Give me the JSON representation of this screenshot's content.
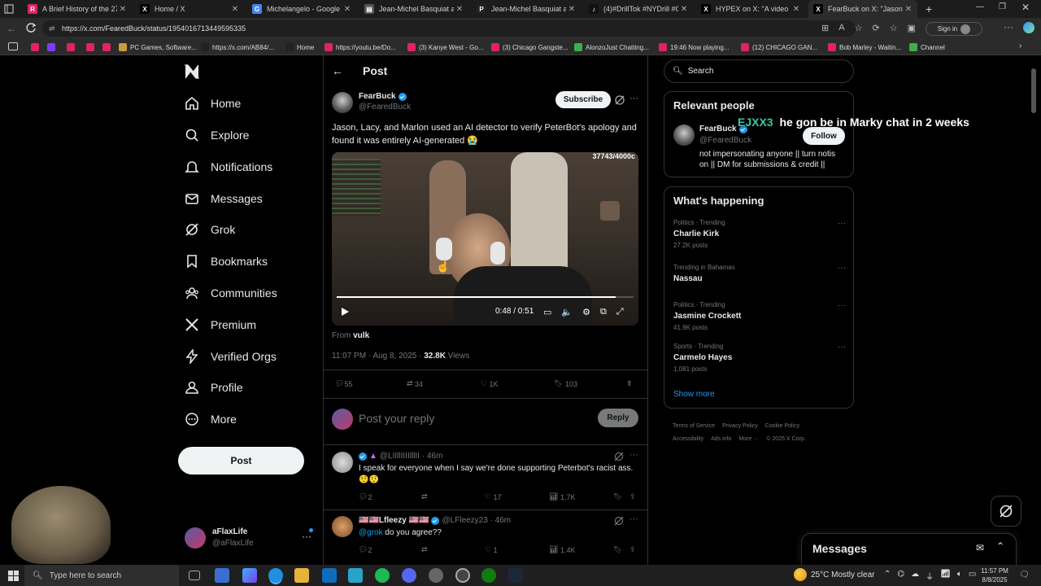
{
  "browser": {
    "tabs": [
      {
        "title": "A Brief History of the 27 Cl",
        "color": "#e0245e",
        "glyph": "R"
      },
      {
        "title": "Home / X",
        "color": "#000000",
        "glyph": "X"
      },
      {
        "title": "Michelangelo - Google Sea",
        "color": "#4285f4",
        "glyph": "G"
      },
      {
        "title": "Jean-Michel Basquiat and A",
        "color": "#555555",
        "glyph": "▤"
      },
      {
        "title": "Jean-Michel Basquiat and A",
        "color": "#222222",
        "glyph": "P"
      },
      {
        "title": "(4)#DrillTok #NYDrill #Chic",
        "color": "#111111",
        "glyph": "♪"
      },
      {
        "title": "HYPEX on X: \"A video surfa",
        "color": "#000000",
        "glyph": "X"
      },
      {
        "title": "FearBuck on X: \"Jason, Lacy",
        "color": "#000000",
        "glyph": "X"
      }
    ],
    "url": "https://x.com/FearedBuck/status/1954016713449595335",
    "sign_in": "Sign in",
    "bookmarks": [
      {
        "label": "",
        "color": "#e0245e"
      },
      {
        "label": "",
        "color": "#7d3cff"
      },
      {
        "label": "",
        "color": "#e0245e"
      },
      {
        "label": "",
        "color": "#e0245e"
      },
      {
        "label": "",
        "color": "#e0245e"
      },
      {
        "label": "PC Games, Software...",
        "color": "#c89b3c"
      },
      {
        "label": "https://x.com/AB84/...",
        "color": "#222222"
      },
      {
        "label": "Home",
        "color": "#222222"
      },
      {
        "label": "https://youtu.be/Do...",
        "color": "#e0245e"
      },
      {
        "label": "(3) Kanye West - Go...",
        "color": "#e0245e"
      },
      {
        "label": "(3) Chicago Gangste...",
        "color": "#e0245e"
      },
      {
        "label": "AlonzoJust Chatting...",
        "color": "#3cb04a"
      },
      {
        "label": "19:46 Now playing...",
        "color": "#e0245e"
      },
      {
        "label": "(12) CHICAGO GAN...",
        "color": "#e0245e"
      },
      {
        "label": "Bob Marley - Waitin...",
        "color": "#e0245e"
      },
      {
        "label": "Channel",
        "color": "#3cb04a"
      }
    ]
  },
  "sidebar": {
    "items": [
      {
        "label": "Home",
        "icon": "home-icon"
      },
      {
        "label": "Explore",
        "icon": "search-icon"
      },
      {
        "label": "Notifications",
        "icon": "bell-icon"
      },
      {
        "label": "Messages",
        "icon": "mail-icon"
      },
      {
        "label": "Grok",
        "icon": "grok-icon"
      },
      {
        "label": "Bookmarks",
        "icon": "bookmark-icon"
      },
      {
        "label": "Communities",
        "icon": "people-icon"
      },
      {
        "label": "Premium",
        "icon": "x-logo-icon"
      },
      {
        "label": "Verified Orgs",
        "icon": "lightning-icon"
      },
      {
        "label": "Profile",
        "icon": "person-icon"
      },
      {
        "label": "More",
        "icon": "more-circle-icon"
      }
    ],
    "post_button": "Post",
    "account": {
      "name": "aFlaxLife",
      "handle": "@aFlaxLife"
    }
  },
  "main": {
    "header_title": "Post",
    "post": {
      "author": "FearBuck",
      "handle": "@FearedBuck",
      "subscribe_label": "Subscribe",
      "text": "Jason, Lacy, and Marlon used an AI detector to verify PeterBot's apology and found it was entirely AI-generated 😭",
      "video": {
        "counter": "37743/4000c",
        "time": "0:48 / 0:51",
        "progress": 0.94
      },
      "from_label": "From",
      "from_name": "vulk",
      "timestamp": "11:07 PM · Aug 8, 2025 ·",
      "views_count": "32.8K",
      "views_label": "Views",
      "stats": {
        "replies": "55",
        "reposts": "34",
        "likes": "1K",
        "bookmarks": "103"
      }
    },
    "reply_box": {
      "placeholder": "Post your reply",
      "button": "Reply"
    },
    "replies": [
      {
        "name": "",
        "handle": "@LIIllIIIIlllII · 46m",
        "text": "I speak for everyone when I say we're done supporting Peterbot's racist ass. 🤨🤨",
        "stats": {
          "replies": "2",
          "reposts": "",
          "likes": "17",
          "views": "1.7K"
        }
      },
      {
        "name": "🇺🇸🇺🇸Lfleezy 🇺🇸🇺🇸",
        "handle": "@LFleezy23 · 46m",
        "mention": "@grok",
        "text": "do you agree??",
        "stats": {
          "replies": "2",
          "reposts": "",
          "likes": "1",
          "views": "1.4K"
        }
      }
    ]
  },
  "right": {
    "search_placeholder": "Search",
    "relevant": {
      "title": "Relevant people",
      "name": "FearBuck",
      "handle": "@FearedBuck",
      "follow": "Follow",
      "bio": "not impersonating anyone || turn notis on || DM for submissions & credit ||"
    },
    "happening": {
      "title": "What's happening",
      "trends": [
        {
          "meta": "Politics · Trending",
          "name": "Charlie Kirk",
          "posts": "27.2K posts"
        },
        {
          "meta": "Trending in Bahamas",
          "name": "Nassau",
          "posts": ""
        },
        {
          "meta": "Politics · Trending",
          "name": "Jasmine Crockett",
          "posts": "41.9K posts"
        },
        {
          "meta": "Sports · Trending",
          "name": "Carmelo Hayes",
          "posts": "1,081 posts"
        }
      ],
      "show_more": "Show more"
    },
    "footer": [
      "Terms of Service",
      "Privacy Policy",
      "Cookie Policy",
      "Accessibility",
      "Ads info",
      "More ···",
      "© 2025 X Corp."
    ],
    "messages_label": "Messages"
  },
  "overlay": {
    "user": "EJXX3",
    "message": "he gon be in Marky chat in 2 weeks"
  },
  "taskbar": {
    "search_placeholder": "Type here to search",
    "weather": "25°C  Mostly clear",
    "time": "11:57 PM",
    "date": "8/8/2025"
  }
}
